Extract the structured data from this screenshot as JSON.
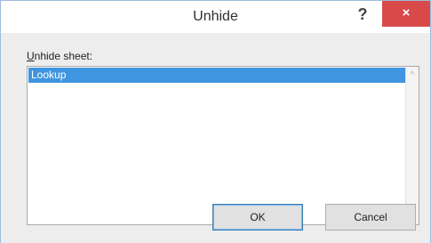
{
  "dialog": {
    "title": "Unhide",
    "help_label": "?",
    "close_label": "×"
  },
  "list": {
    "label_accel": "U",
    "label_rest": "nhide sheet:",
    "items": [
      "Lookup"
    ],
    "selected_index": 0,
    "scroll_up": "^",
    "scroll_down": "v"
  },
  "buttons": {
    "ok": "OK",
    "cancel": "Cancel"
  }
}
